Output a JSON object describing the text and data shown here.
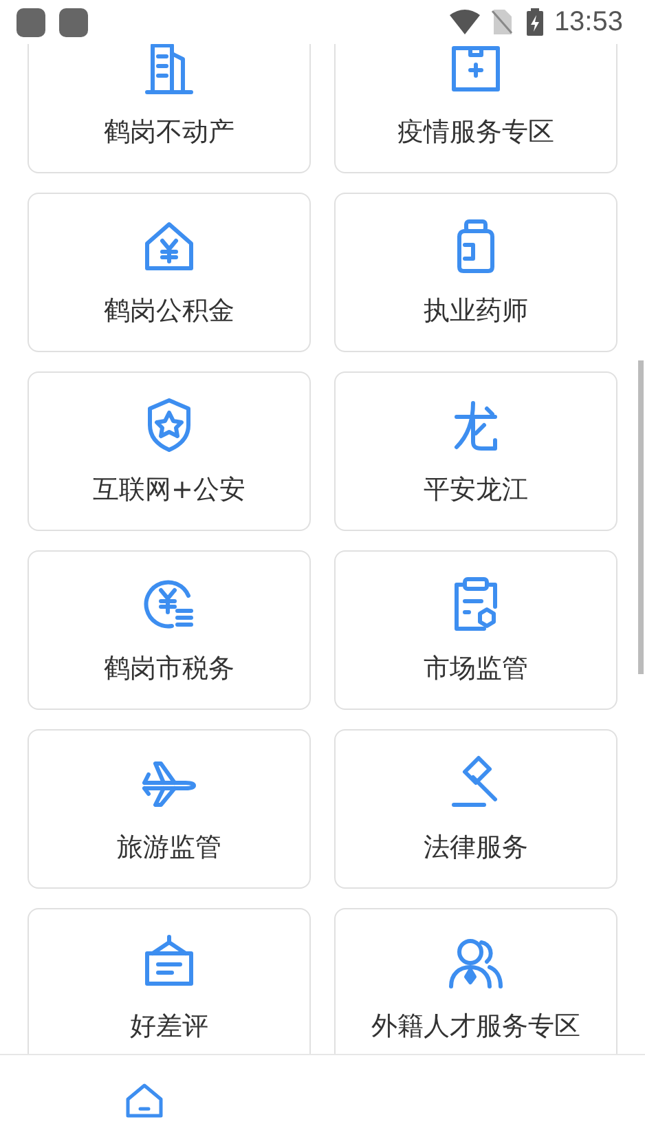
{
  "status_bar": {
    "time": "13:53"
  },
  "services": [
    {
      "label": "鹤岗不动产"
    },
    {
      "label": "疫情服务专区"
    },
    {
      "label": "鹤岗公积金"
    },
    {
      "label": "执业药师"
    },
    {
      "label": "互联网+公安"
    },
    {
      "label": "平安龙江"
    },
    {
      "label": "鹤岗市税务"
    },
    {
      "label": "市场监管"
    },
    {
      "label": "旅游监管"
    },
    {
      "label": "法律服务"
    },
    {
      "label": "好差评"
    },
    {
      "label": "外籍人才服务专区"
    }
  ],
  "tab_bar": {
    "tabs": [
      {
        "selected": true
      }
    ]
  }
}
